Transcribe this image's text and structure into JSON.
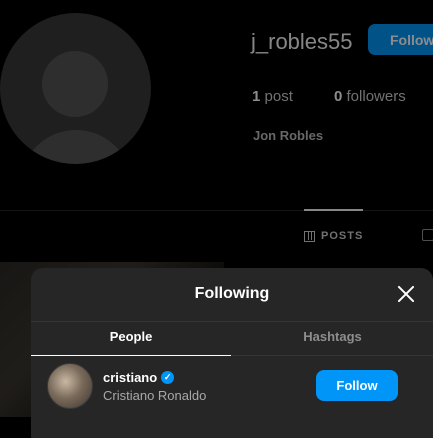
{
  "profile": {
    "username": "j_robles55",
    "follow_label": "Follow",
    "posts_count": "1",
    "posts_label": "post",
    "followers_count": "0",
    "followers_label": "followers",
    "full_name": "Jon Robles",
    "tab_posts_label": "POSTS"
  },
  "modal": {
    "title": "Following",
    "tabs": [
      {
        "label": "People",
        "active": true
      },
      {
        "label": "Hashtags",
        "active": false
      }
    ],
    "list": [
      {
        "username": "cristiano",
        "verified": true,
        "full_name": "Cristiano Ronaldo",
        "button_label": "Follow"
      }
    ]
  },
  "colors": {
    "accent": "#0095f6",
    "modal_bg": "#262626",
    "page_bg": "#000000"
  }
}
